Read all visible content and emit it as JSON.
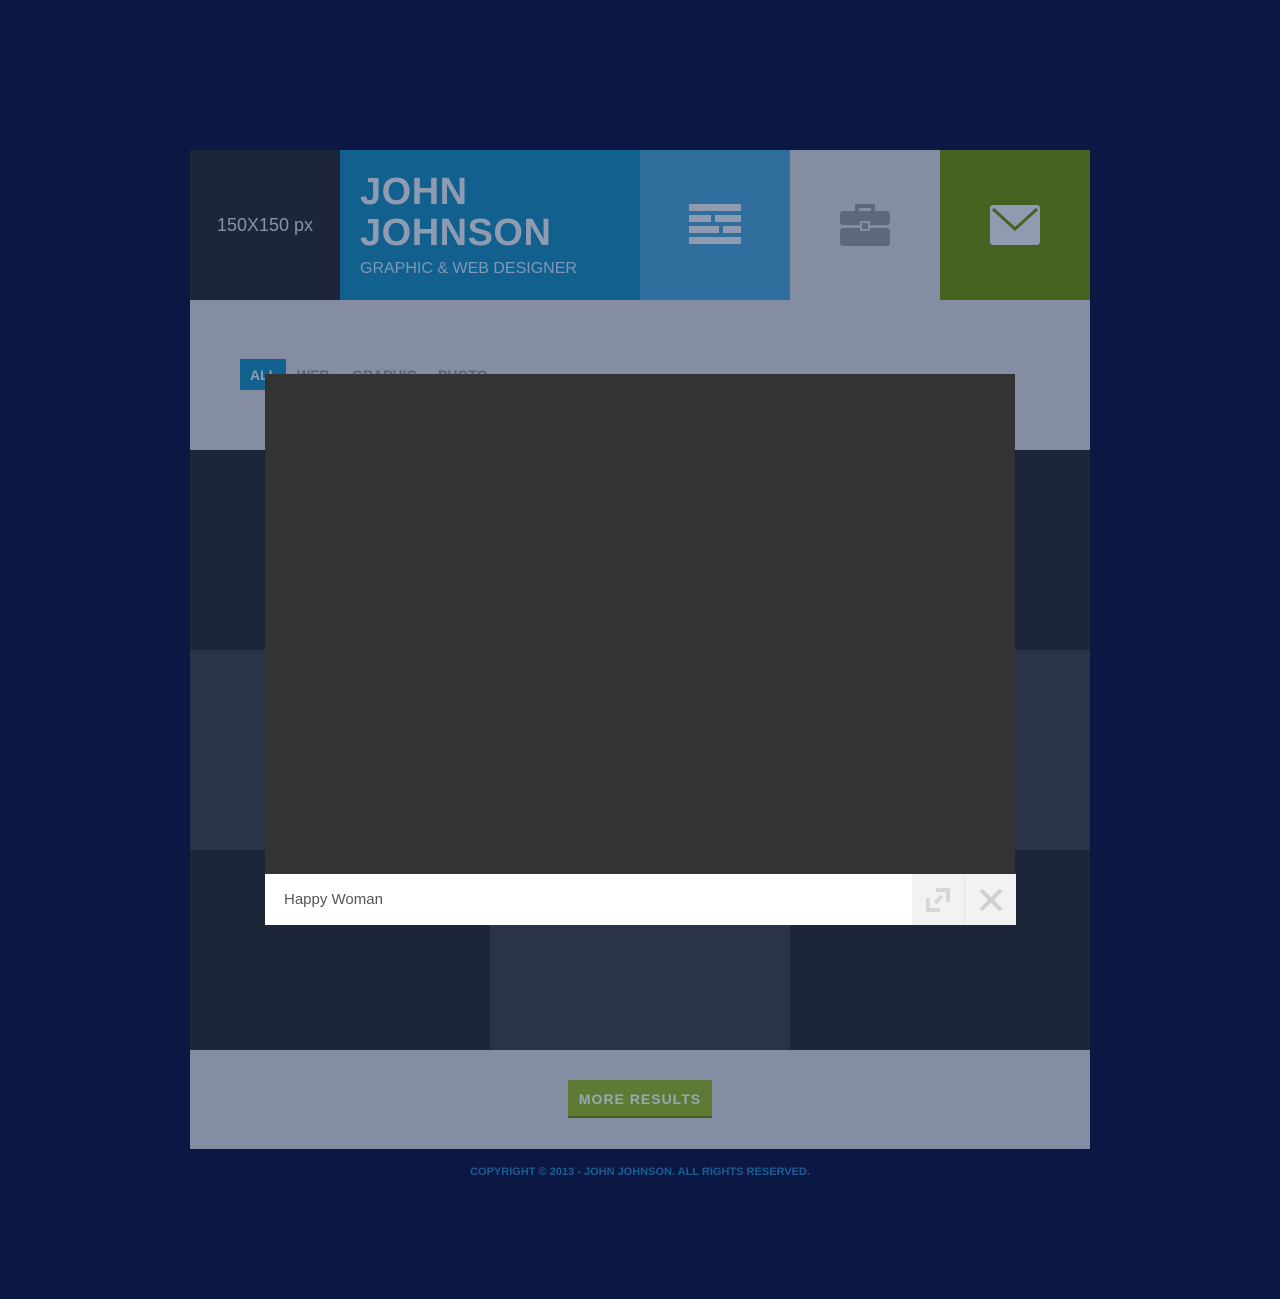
{
  "header": {
    "avatar_placeholder": "150X150 px",
    "name_first": "JOHN",
    "name_last": "JOHNSON",
    "subtitle": "GRAPHIC & WEB DESIGNER",
    "tiles": [
      {
        "icon": "menu-icon"
      },
      {
        "icon": "briefcase-icon"
      },
      {
        "icon": "envelope-icon"
      }
    ]
  },
  "filters": {
    "items": [
      "ALL",
      "WEB",
      "GRAPHIC",
      "PHOTO"
    ],
    "active": "ALL"
  },
  "lightbox": {
    "caption": "Happy Woman",
    "buttons": [
      {
        "icon": "expand-icon"
      },
      {
        "icon": "close-icon"
      }
    ]
  },
  "more_button": "MORE RESULTS",
  "footer": {
    "copyright": "COPYRIGHT © 2013 - JOHN JOHNSON. ALL RIGHTS RESERVED."
  },
  "colors": {
    "background": "#0a1843",
    "accent_blue": "#11608e",
    "accent_green": "#446321"
  }
}
